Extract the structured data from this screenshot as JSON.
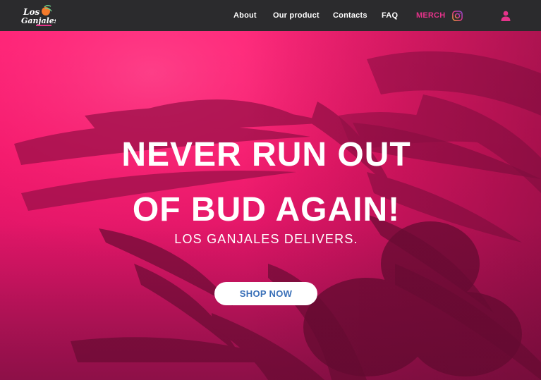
{
  "nav": {
    "logo_text": "Los Ganjales",
    "links": {
      "about": "About",
      "product": "Our product",
      "contacts": "Contacts",
      "faq": "FAQ",
      "merch": "MERCH"
    },
    "icons": {
      "instagram": "instagram-icon",
      "user": "user-icon"
    },
    "colors": {
      "background": "#2b2b2d",
      "accent": "#e5338a"
    }
  },
  "hero": {
    "headline_line1": "NEVER RUN OUT",
    "headline_line2": "OF BUD AGAIN!",
    "subheadline": "LOS GANJALES DELIVERS.",
    "cta_label": "SHOP NOW",
    "colors": {
      "background": "#ff1f74",
      "cta_text": "#3a70b8"
    }
  }
}
